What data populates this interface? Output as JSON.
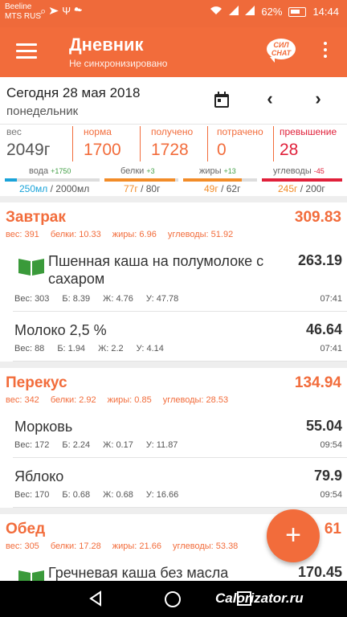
{
  "status_bar": {
    "carrier1": "Beeline",
    "carrier2": "MTS RUS",
    "battery": "62%",
    "time": "14:44"
  },
  "app_bar": {
    "title": "Дневник",
    "subtitle": "Не синхронизировано",
    "chat_label_top": "СИЛ",
    "chat_label_bottom": "CHAT"
  },
  "date": {
    "main": "Сегодня 28 мая 2018",
    "weekday": "понедельник"
  },
  "stats": [
    {
      "label": "вес",
      "value": "2049г",
      "color": "#555555"
    },
    {
      "label": "норма",
      "value": "1700",
      "color": "#f26c3b"
    },
    {
      "label": "получено",
      "value": "1728",
      "color": "#f26c3b"
    },
    {
      "label": "потрачено",
      "value": "0",
      "color": "#f26c3b"
    },
    {
      "label": "превышение",
      "value": "28",
      "color": "#e0203a"
    }
  ],
  "bars": [
    {
      "name": "вода",
      "delta": "+1750",
      "delta_color": "#43a047",
      "current": "250мл",
      "total": " / 2000мл",
      "current_color": "#1aa3d9",
      "fill": 0.125,
      "fill_color": "#1aa3d9"
    },
    {
      "name": "белки",
      "delta": "+3",
      "delta_color": "#43a047",
      "current": "77г",
      "total": " / 80г",
      "current_color": "#f28c28",
      "fill": 0.96,
      "fill_color": "#f28c28"
    },
    {
      "name": "жиры",
      "delta": "+13",
      "delta_color": "#43a047",
      "current": "49г",
      "total": " / 62г",
      "current_color": "#f28c28",
      "fill": 0.79,
      "fill_color": "#f28c28"
    },
    {
      "name": "углеводы",
      "delta": "-45",
      "delta_color": "#e0203a",
      "current": "245г",
      "total": " / 200г",
      "current_color": "#f28c28",
      "fill": 1.0,
      "fill_color": "#e0203a"
    }
  ],
  "meals": [
    {
      "name": "Завтрак",
      "total": "309.83",
      "macros": {
        "ves": "вес: 391",
        "b": "белки: 10.33",
        "zh": "жиры: 6.96",
        "u": "углеводы: 51.92"
      },
      "foods": [
        {
          "name": "Пшенная каша на полумолоке с сахаром",
          "cal": "263.19",
          "ves": "Вес: 303",
          "b": "Б: 8.39",
          "zh": "Ж: 4.76",
          "u": "У: 47.78",
          "time": "07:41",
          "icon": "book-icon"
        },
        {
          "name": "Молоко 2,5 %",
          "cal": "46.64",
          "ves": "Вес: 88",
          "b": "Б: 1.94",
          "zh": "Ж: 2.2",
          "u": "У: 4.14",
          "time": "07:41"
        }
      ]
    },
    {
      "name": "Перекус",
      "total": "134.94",
      "macros": {
        "ves": "вес: 342",
        "b": "белки: 2.92",
        "zh": "жиры: 0.85",
        "u": "углеводы: 28.53"
      },
      "foods": [
        {
          "name": "Морковь",
          "cal": "55.04",
          "ves": "Вес: 172",
          "b": "Б: 2.24",
          "zh": "Ж: 0.17",
          "u": "У: 11.87",
          "time": "09:54"
        },
        {
          "name": "Яблоко",
          "cal": "79.9",
          "ves": "Вес: 170",
          "b": "Б: 0.68",
          "zh": "Ж: 0.68",
          "u": "У: 16.66",
          "time": "09:54"
        }
      ]
    },
    {
      "name": "Обед",
      "total": "61",
      "macros": {
        "ves": "вес: 305",
        "b": "белки: 17.28",
        "zh": "жиры: 21.66",
        "u": "углеводы: 53.38"
      },
      "foods": [
        {
          "name": "Гречневая каша без масла",
          "cal": "170.45",
          "icon": "book-icon"
        }
      ]
    }
  ],
  "fab": {
    "label": "+"
  },
  "watermark": "Calorizator.ru"
}
